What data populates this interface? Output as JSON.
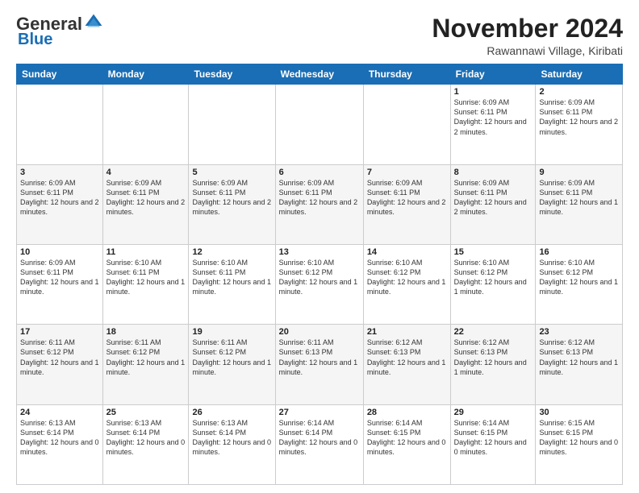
{
  "logo": {
    "general": "General",
    "blue": "Blue"
  },
  "header": {
    "month": "November 2024",
    "location": "Rawannawi Village, Kiribati"
  },
  "days_of_week": [
    "Sunday",
    "Monday",
    "Tuesday",
    "Wednesday",
    "Thursday",
    "Friday",
    "Saturday"
  ],
  "weeks": [
    [
      {
        "day": "",
        "sunrise": "",
        "sunset": "",
        "daylight": "",
        "empty": true
      },
      {
        "day": "",
        "sunrise": "",
        "sunset": "",
        "daylight": "",
        "empty": true
      },
      {
        "day": "",
        "sunrise": "",
        "sunset": "",
        "daylight": "",
        "empty": true
      },
      {
        "day": "",
        "sunrise": "",
        "sunset": "",
        "daylight": "",
        "empty": true
      },
      {
        "day": "",
        "sunrise": "",
        "sunset": "",
        "daylight": "",
        "empty": true
      },
      {
        "day": "1",
        "sunrise": "Sunrise: 6:09 AM",
        "sunset": "Sunset: 6:11 PM",
        "daylight": "Daylight: 12 hours and 2 minutes."
      },
      {
        "day": "2",
        "sunrise": "Sunrise: 6:09 AM",
        "sunset": "Sunset: 6:11 PM",
        "daylight": "Daylight: 12 hours and 2 minutes."
      }
    ],
    [
      {
        "day": "3",
        "sunrise": "Sunrise: 6:09 AM",
        "sunset": "Sunset: 6:11 PM",
        "daylight": "Daylight: 12 hours and 2 minutes."
      },
      {
        "day": "4",
        "sunrise": "Sunrise: 6:09 AM",
        "sunset": "Sunset: 6:11 PM",
        "daylight": "Daylight: 12 hours and 2 minutes."
      },
      {
        "day": "5",
        "sunrise": "Sunrise: 6:09 AM",
        "sunset": "Sunset: 6:11 PM",
        "daylight": "Daylight: 12 hours and 2 minutes."
      },
      {
        "day": "6",
        "sunrise": "Sunrise: 6:09 AM",
        "sunset": "Sunset: 6:11 PM",
        "daylight": "Daylight: 12 hours and 2 minutes."
      },
      {
        "day": "7",
        "sunrise": "Sunrise: 6:09 AM",
        "sunset": "Sunset: 6:11 PM",
        "daylight": "Daylight: 12 hours and 2 minutes."
      },
      {
        "day": "8",
        "sunrise": "Sunrise: 6:09 AM",
        "sunset": "Sunset: 6:11 PM",
        "daylight": "Daylight: 12 hours and 2 minutes."
      },
      {
        "day": "9",
        "sunrise": "Sunrise: 6:09 AM",
        "sunset": "Sunset: 6:11 PM",
        "daylight": "Daylight: 12 hours and 1 minute."
      }
    ],
    [
      {
        "day": "10",
        "sunrise": "Sunrise: 6:09 AM",
        "sunset": "Sunset: 6:11 PM",
        "daylight": "Daylight: 12 hours and 1 minute."
      },
      {
        "day": "11",
        "sunrise": "Sunrise: 6:10 AM",
        "sunset": "Sunset: 6:11 PM",
        "daylight": "Daylight: 12 hours and 1 minute."
      },
      {
        "day": "12",
        "sunrise": "Sunrise: 6:10 AM",
        "sunset": "Sunset: 6:11 PM",
        "daylight": "Daylight: 12 hours and 1 minute."
      },
      {
        "day": "13",
        "sunrise": "Sunrise: 6:10 AM",
        "sunset": "Sunset: 6:12 PM",
        "daylight": "Daylight: 12 hours and 1 minute."
      },
      {
        "day": "14",
        "sunrise": "Sunrise: 6:10 AM",
        "sunset": "Sunset: 6:12 PM",
        "daylight": "Daylight: 12 hours and 1 minute."
      },
      {
        "day": "15",
        "sunrise": "Sunrise: 6:10 AM",
        "sunset": "Sunset: 6:12 PM",
        "daylight": "Daylight: 12 hours and 1 minute."
      },
      {
        "day": "16",
        "sunrise": "Sunrise: 6:10 AM",
        "sunset": "Sunset: 6:12 PM",
        "daylight": "Daylight: 12 hours and 1 minute."
      }
    ],
    [
      {
        "day": "17",
        "sunrise": "Sunrise: 6:11 AM",
        "sunset": "Sunset: 6:12 PM",
        "daylight": "Daylight: 12 hours and 1 minute."
      },
      {
        "day": "18",
        "sunrise": "Sunrise: 6:11 AM",
        "sunset": "Sunset: 6:12 PM",
        "daylight": "Daylight: 12 hours and 1 minute."
      },
      {
        "day": "19",
        "sunrise": "Sunrise: 6:11 AM",
        "sunset": "Sunset: 6:12 PM",
        "daylight": "Daylight: 12 hours and 1 minute."
      },
      {
        "day": "20",
        "sunrise": "Sunrise: 6:11 AM",
        "sunset": "Sunset: 6:13 PM",
        "daylight": "Daylight: 12 hours and 1 minute."
      },
      {
        "day": "21",
        "sunrise": "Sunrise: 6:12 AM",
        "sunset": "Sunset: 6:13 PM",
        "daylight": "Daylight: 12 hours and 1 minute."
      },
      {
        "day": "22",
        "sunrise": "Sunrise: 6:12 AM",
        "sunset": "Sunset: 6:13 PM",
        "daylight": "Daylight: 12 hours and 1 minute."
      },
      {
        "day": "23",
        "sunrise": "Sunrise: 6:12 AM",
        "sunset": "Sunset: 6:13 PM",
        "daylight": "Daylight: 12 hours and 1 minute."
      }
    ],
    [
      {
        "day": "24",
        "sunrise": "Sunrise: 6:13 AM",
        "sunset": "Sunset: 6:14 PM",
        "daylight": "Daylight: 12 hours and 0 minutes."
      },
      {
        "day": "25",
        "sunrise": "Sunrise: 6:13 AM",
        "sunset": "Sunset: 6:14 PM",
        "daylight": "Daylight: 12 hours and 0 minutes."
      },
      {
        "day": "26",
        "sunrise": "Sunrise: 6:13 AM",
        "sunset": "Sunset: 6:14 PM",
        "daylight": "Daylight: 12 hours and 0 minutes."
      },
      {
        "day": "27",
        "sunrise": "Sunrise: 6:14 AM",
        "sunset": "Sunset: 6:14 PM",
        "daylight": "Daylight: 12 hours and 0 minutes."
      },
      {
        "day": "28",
        "sunrise": "Sunrise: 6:14 AM",
        "sunset": "Sunset: 6:15 PM",
        "daylight": "Daylight: 12 hours and 0 minutes."
      },
      {
        "day": "29",
        "sunrise": "Sunrise: 6:14 AM",
        "sunset": "Sunset: 6:15 PM",
        "daylight": "Daylight: 12 hours and 0 minutes."
      },
      {
        "day": "30",
        "sunrise": "Sunrise: 6:15 AM",
        "sunset": "Sunset: 6:15 PM",
        "daylight": "Daylight: 12 hours and 0 minutes."
      }
    ]
  ]
}
